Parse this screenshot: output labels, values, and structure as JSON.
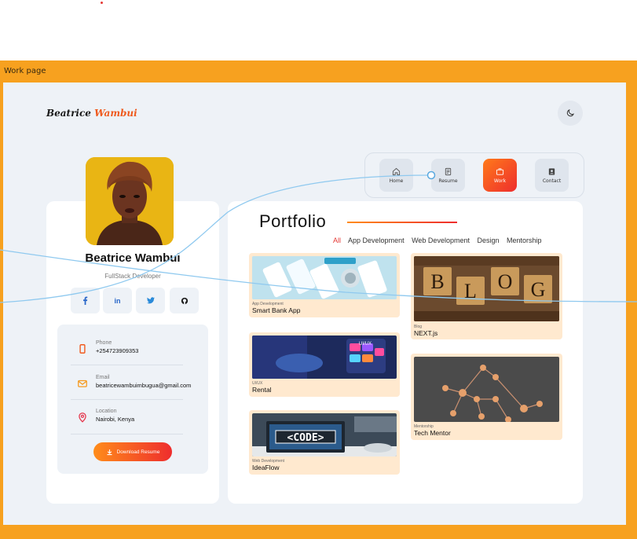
{
  "frame_label": "Work page",
  "brand": {
    "first": "Beatrice",
    "last": "Wambui"
  },
  "nav": [
    {
      "label": "Home",
      "icon": "home-icon"
    },
    {
      "label": "Resume",
      "icon": "document-icon"
    },
    {
      "label": "Work",
      "icon": "briefcase-icon"
    },
    {
      "label": "Contact",
      "icon": "contact-card-icon"
    }
  ],
  "profile": {
    "name": "Beatrice Wambui",
    "role": "FullStack Developer",
    "social": [
      "f",
      "in",
      "twitter",
      "github"
    ],
    "phone_label": "Phone",
    "phone": "+254723909353",
    "email_label": "Email",
    "email": "beatricewambuimbugua@gmail.com",
    "location_label": "Location",
    "location": "Nairobi, Kenya",
    "download_label": "Download Resume"
  },
  "portfolio": {
    "title": "Portfolio",
    "filters": [
      "All",
      "App Development",
      "Web Development",
      "Design",
      "Mentorship"
    ],
    "projects": [
      {
        "category": "App Development",
        "title": "Smart Bank App"
      },
      {
        "category": "Blog",
        "title": "NEXT.js"
      },
      {
        "category": "UI/UX",
        "title": "Rental"
      },
      {
        "category": "Mentorship",
        "title": "Tech Mentor"
      },
      {
        "category": "Web Development",
        "title": "IdeaFlow"
      }
    ],
    "image_text": {
      "blog": [
        "B",
        "L",
        "O",
        "G"
      ],
      "code": "<CODE>",
      "uiux": "UI/UX"
    }
  },
  "colors": {
    "frame": "#f7a11f",
    "accent": "#ee2d2d",
    "accent2": "#ff8c1a",
    "page": "#eef2f7"
  }
}
